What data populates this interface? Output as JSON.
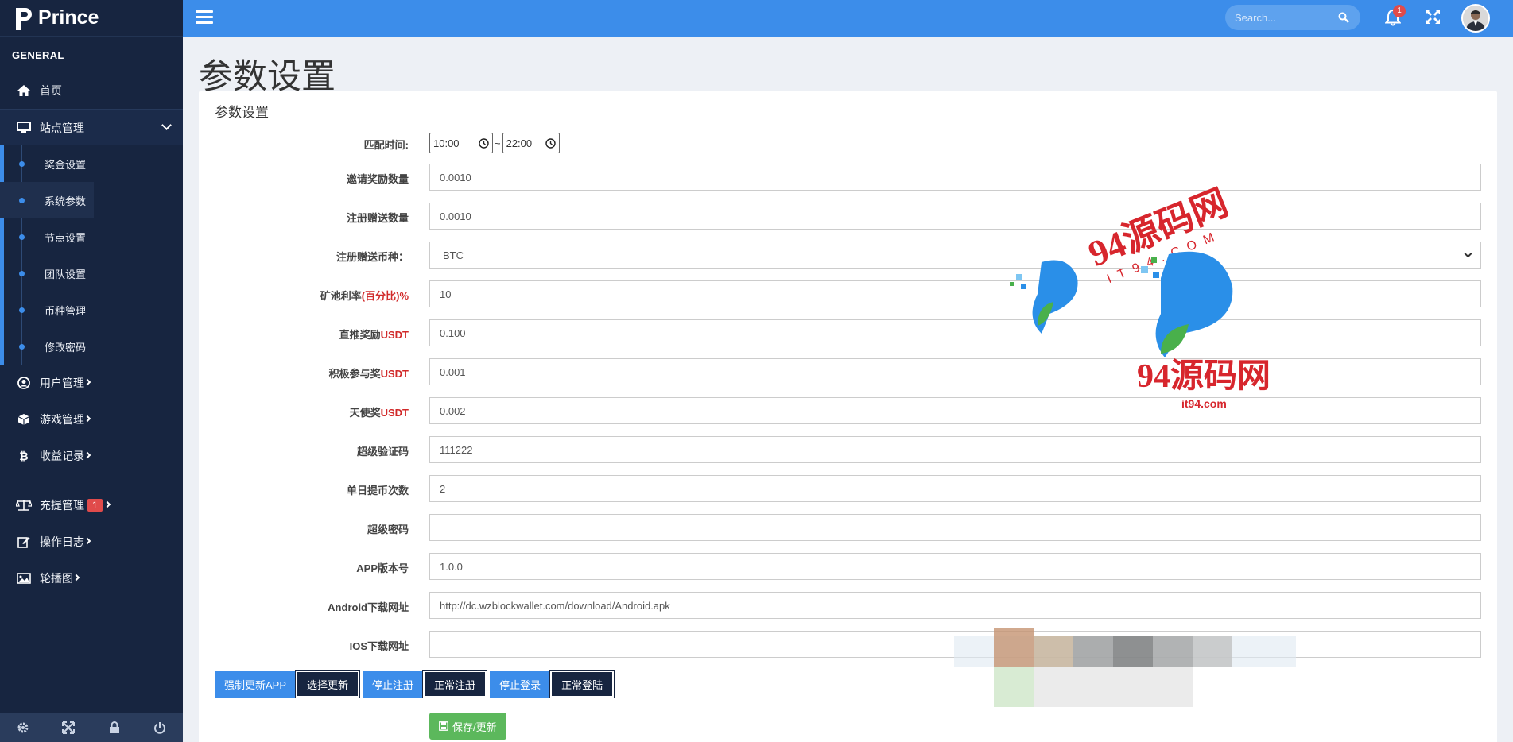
{
  "brand": {
    "name": "Prince"
  },
  "sidebar": {
    "section_title": "GENERAL",
    "items": [
      {
        "label": "首页",
        "icon": "home-icon"
      },
      {
        "label": "站点管理",
        "icon": "monitor-icon"
      },
      {
        "label": "用户管理",
        "icon": "user-icon"
      },
      {
        "label": "游戏管理",
        "icon": "cube-icon"
      },
      {
        "label": "收益记录",
        "icon": "bitcoin-icon"
      },
      {
        "label": "充提管理",
        "icon": "scale-icon",
        "badge": "1"
      },
      {
        "label": "操作日志",
        "icon": "edit-icon"
      },
      {
        "label": "轮播图",
        "icon": "image-icon"
      }
    ],
    "subitems": [
      "奖金设置",
      "系统参数",
      "节点设置",
      "团队设置",
      "币种管理",
      "修改密码"
    ],
    "footer_icons": [
      "settings-icon",
      "fullscreen-icon",
      "lock-icon",
      "power-icon"
    ]
  },
  "topbar": {
    "search_placeholder": "Search...",
    "notification_count": "1"
  },
  "page": {
    "title": "参数设置",
    "card_title": "参数设置"
  },
  "form": {
    "match_time": {
      "label": "匹配时间:",
      "start": "10:00",
      "sep": "~",
      "end": "22:00"
    },
    "fields": [
      {
        "label": "邀请奖励数量",
        "value": "0.0010"
      },
      {
        "label": "注册赠送数量",
        "value": "0.0010"
      },
      {
        "label": "注册赠送币种：",
        "value": "BTC",
        "type": "select"
      },
      {
        "label_pre": "矿池利率",
        "label_red": "(百分比)%",
        "value": "10"
      },
      {
        "label_pre": "直推奖励",
        "label_red": "USDT",
        "value": "0.100"
      },
      {
        "label_pre": "积极参与奖",
        "label_red": "USDT",
        "value": "0.001"
      },
      {
        "label_pre": "天使奖",
        "label_red": "USDT",
        "value": "0.002"
      },
      {
        "label": "超级验证码",
        "value": "111222"
      },
      {
        "label": "单日提币次数",
        "value": "2"
      },
      {
        "label": "超级密码",
        "value": ""
      },
      {
        "label": "APP版本号",
        "value": "1.0.0"
      },
      {
        "label": "Android下载网址",
        "value": "http://dc.wzblockwallet.com/download/Android.apk"
      },
      {
        "label": "IOS下载网址",
        "value": ""
      }
    ]
  },
  "buttons": {
    "force_update": "强制更新APP",
    "select_update": "选择更新",
    "stop_register": "停止注册",
    "normal_register": "正常注册",
    "stop_login": "停止登录",
    "normal_login": "正常登陆",
    "save": "保存/更新"
  },
  "watermark": {
    "text1": "94源码网",
    "text2": "IT94.COM",
    "text3": "94源码网",
    "text4": "it94.com"
  },
  "colors": {
    "sidebar": "#172540",
    "accent": "#3c8dea",
    "danger": "#e04b4b",
    "success": "#5cb85c"
  }
}
